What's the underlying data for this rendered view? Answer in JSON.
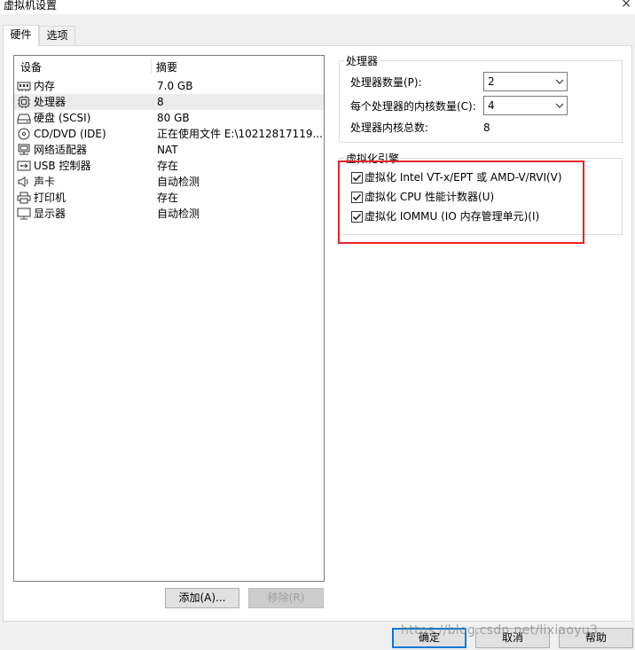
{
  "window": {
    "title": "虚拟机设置",
    "close_glyph": "×"
  },
  "tabs": [
    {
      "label": "硬件",
      "active": true
    },
    {
      "label": "选项",
      "active": false
    }
  ],
  "device_list": {
    "columns": [
      "设备",
      "摘要"
    ],
    "rows": [
      {
        "icon": "memory-icon",
        "name": "内存",
        "summary": "7.0 GB",
        "selected": false
      },
      {
        "icon": "processor-icon",
        "name": "处理器",
        "summary": "8",
        "selected": true
      },
      {
        "icon": "hard-disk-icon",
        "name": "硬盘 (SCSI)",
        "summary": "80 GB",
        "selected": false
      },
      {
        "icon": "cd-dvd-icon",
        "name": "CD/DVD (IDE)",
        "summary": "正在使用文件 E:\\10212817119...",
        "selected": false
      },
      {
        "icon": "network-adapter-icon",
        "name": "网络适配器",
        "summary": "NAT",
        "selected": false
      },
      {
        "icon": "usb-icon",
        "name": "USB 控制器",
        "summary": "存在",
        "selected": false
      },
      {
        "icon": "sound-card-icon",
        "name": "声卡",
        "summary": "自动检测",
        "selected": false
      },
      {
        "icon": "printer-icon",
        "name": "打印机",
        "summary": "存在",
        "selected": false
      },
      {
        "icon": "display-icon",
        "name": "显示器",
        "summary": "自动检测",
        "selected": false
      }
    ],
    "add_button": "添加(A)...",
    "remove_button": "移除(R)"
  },
  "processor": {
    "group_title": "处理器",
    "count_label": "处理器数量(P):",
    "count_value": "2",
    "cores_label": "每个处理器的内核数量(C):",
    "cores_value": "4",
    "total_label": "处理器内核总数:",
    "total_value": "8"
  },
  "virtualization": {
    "group_title": "虚拟化引擎",
    "options": [
      {
        "label": "虚拟化 Intel VT-x/EPT 或 AMD-V/RVI(V)",
        "checked": true
      },
      {
        "label": "虚拟化 CPU 性能计数器(U)",
        "checked": true
      },
      {
        "label": "虚拟化 IOMMU (IO 内存管理单元)(I)",
        "checked": true
      }
    ],
    "highlight_color": "#e5242a"
  },
  "footer": {
    "ok": "确定",
    "cancel": "取消",
    "help": "帮助"
  },
  "watermark": "https://blog.csdn.net/lixiaoyu3"
}
